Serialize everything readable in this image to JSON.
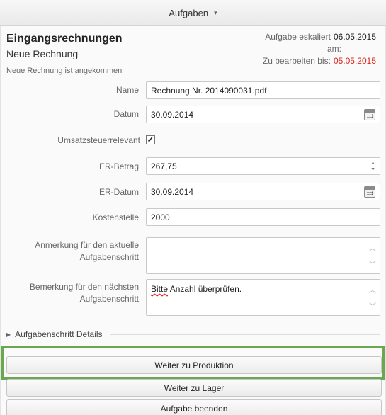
{
  "header": {
    "title": "Aufgaben",
    "caret": "▾"
  },
  "task": {
    "title": "Eingangsrechnungen",
    "subtitle": "Neue Rechnung",
    "note": "Neue Rechnung ist angekommen",
    "escalated_label": "Aufgabe eskaliert",
    "escalated_label2": "am:",
    "escalated_date": "06.05.2015",
    "due_label": "Zu bearbeiten bis:",
    "due_date": "05.05.2015",
    "due_color": "#d9261c"
  },
  "form": {
    "name_label": "Name",
    "name_value": "Rechnung Nr. 2014090031.pdf",
    "datum_label": "Datum",
    "datum_value": "30.09.2014",
    "ust_label": "Umsatzsteuerrelevant",
    "ust_checked": "✓",
    "betrag_label": "ER-Betrag",
    "betrag_value": "267,75",
    "erdatum_label": "ER-Datum",
    "erdatum_value": "30.09.2014",
    "kostenstelle_label": "Kostenstelle",
    "kostenstelle_value": "2000",
    "anmerkung_label_1": "Anmerkung für den aktuelle",
    "anmerkung_label_2": "Aufgabenschritt",
    "anmerkung_value": "",
    "bemerkung_label_1": "Bemerkung für den nächsten",
    "bemerkung_label_2": "Aufgabenschritt",
    "bemerkung_word_1": "Bitte",
    "bemerkung_rest": " Anzahl überprüfen."
  },
  "details": {
    "label": "Aufgabenschritt Details"
  },
  "buttons": {
    "production": "Weiter zu Produktion",
    "lager": "Weiter zu Lager",
    "beenden": "Aufgabe beenden"
  },
  "icons": {
    "calendar": "calendar-icon",
    "spinner": "spinner-icon",
    "expand": "triangle-right-icon"
  },
  "colors": {
    "highlight": "#6aa84f",
    "error": "#d9261c"
  }
}
